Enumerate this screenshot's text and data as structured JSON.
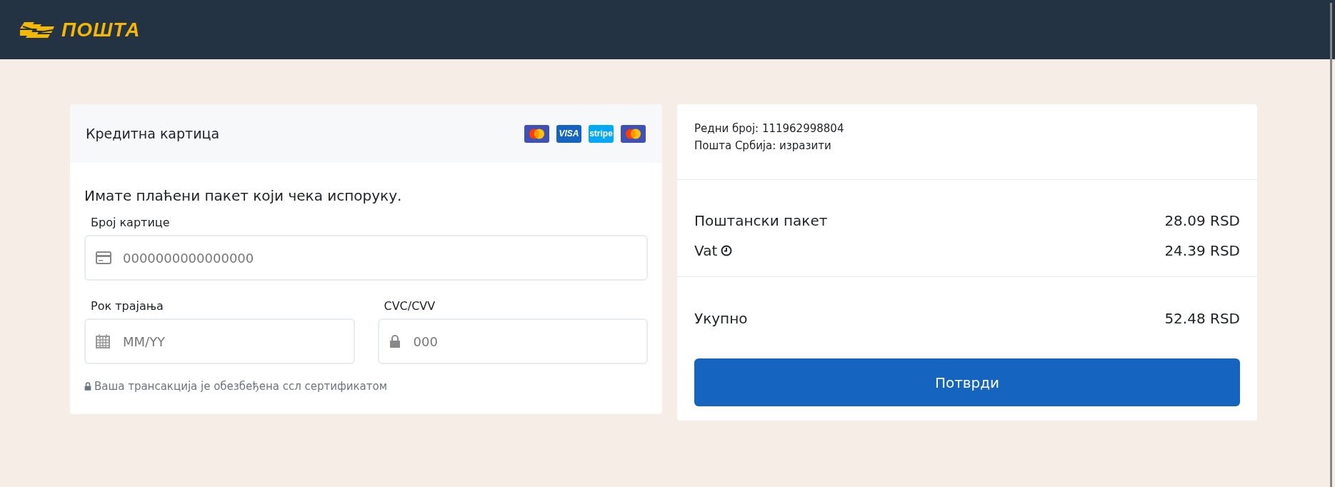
{
  "header": {
    "logo_text": "ПОШТА"
  },
  "payment_form": {
    "title": "Кредитна картица",
    "payment_logos": [
      {
        "kind": "mastercard"
      },
      {
        "kind": "visa",
        "label": "VISA"
      },
      {
        "kind": "stripe",
        "label": "stripe"
      },
      {
        "kind": "mastercard"
      }
    ],
    "message": "Имате плаћени пакет који чека испоруку.",
    "fields": [
      {
        "kind": "card",
        "label": "Број картице",
        "placeholder": "0000000000000000"
      },
      {
        "kind": "expiry",
        "label": "Рок трајања",
        "placeholder": "MM/YY"
      },
      {
        "kind": "cvc",
        "label": "CVC/CVV",
        "placeholder": "000"
      }
    ],
    "security_note": "Ваша трансакција је обезбеђена ссл сертификатом"
  },
  "summary": {
    "info": [
      "Редни број: 111962998804",
      "Пошта Србија: изразити"
    ],
    "items": [
      {
        "label": "Поштански пакет",
        "amount": "28.09 RSD",
        "info_icon": false
      },
      {
        "label": "Vat",
        "amount": "24.39 RSD",
        "info_icon": true
      }
    ],
    "total": {
      "label": "Укупно",
      "amount": "52.48 RSD"
    },
    "confirm_button": "Потврди"
  }
}
